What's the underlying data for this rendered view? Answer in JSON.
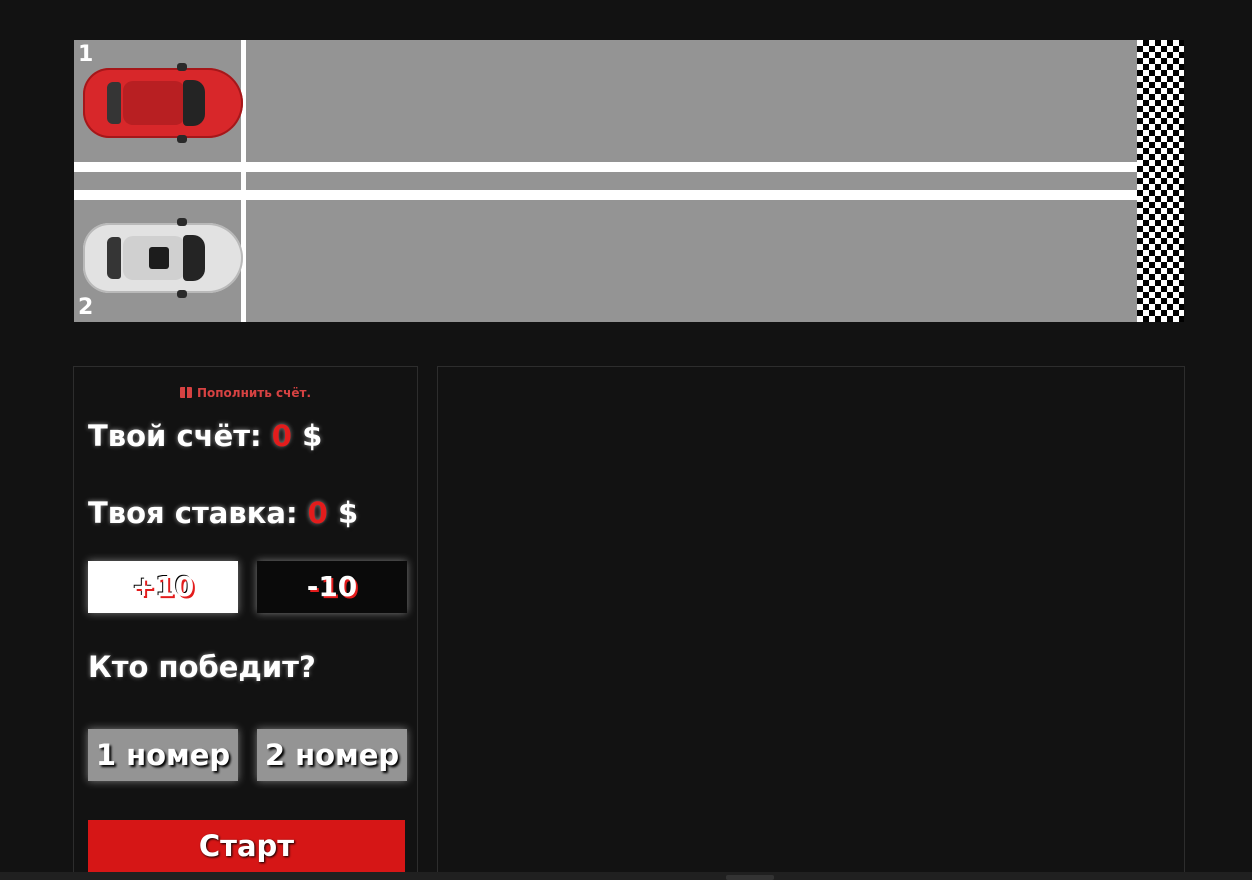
{
  "track": {
    "lane1_number": "1",
    "lane2_number": "2",
    "car1_color": "#d8272a",
    "car2_color": "#e2e2e2"
  },
  "sidebar": {
    "topup_link": "Пополнить счёт.",
    "topup_icon": "gift-icon",
    "balance_label": "Твой счёт:",
    "balance_value": "0",
    "balance_currency": "$",
    "bet_label": "Твоя ставка:",
    "bet_value": "0",
    "bet_currency": "$",
    "plus_button": "+10",
    "minus_button": "-10",
    "question": "Кто победит?",
    "pick1_button": "1 номер",
    "pick2_button": "2 номер",
    "start_button": "Старт"
  },
  "colors": {
    "accent_red": "#e31c1c",
    "track_gray": "#949494",
    "background": "#121212"
  }
}
